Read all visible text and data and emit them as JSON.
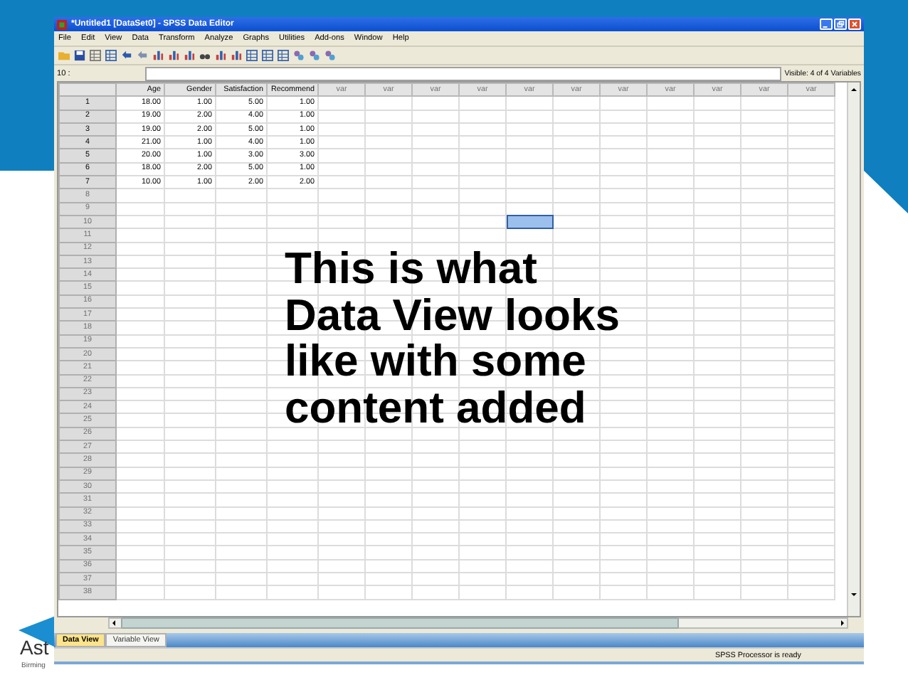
{
  "slide": {
    "caption": "This is what\nData View looks\nlike with some\ncontent added",
    "logo": {
      "name": "Ast",
      "subtitle": "Birming"
    }
  },
  "window": {
    "title": "*Untitled1 [DataSet0] - SPSS Data Editor"
  },
  "menu": [
    "File",
    "Edit",
    "View",
    "Data",
    "Transform",
    "Analyze",
    "Graphs",
    "Utilities",
    "Add-ons",
    "Window",
    "Help"
  ],
  "cell_editor": {
    "cell_ref": "10 :",
    "visible": "Visible: 4 of 4 Variables"
  },
  "table": {
    "columns": [
      {
        "label": "Age",
        "kind": "variable",
        "selected": false
      },
      {
        "label": "Gender",
        "kind": "variable",
        "selected": false
      },
      {
        "label": "Satisfaction",
        "kind": "variable",
        "selected": false
      },
      {
        "label": "Recommend",
        "kind": "variable",
        "selected": false
      },
      {
        "label": "var",
        "kind": "empty",
        "selected": false
      },
      {
        "label": "var",
        "kind": "empty",
        "selected": false
      },
      {
        "label": "var",
        "kind": "empty",
        "selected": false
      },
      {
        "label": "var",
        "kind": "empty",
        "selected": false
      },
      {
        "label": "var",
        "kind": "empty",
        "selected": true
      },
      {
        "label": "var",
        "kind": "empty",
        "selected": false
      },
      {
        "label": "var",
        "kind": "empty",
        "selected": false
      },
      {
        "label": "var",
        "kind": "empty",
        "selected": false
      },
      {
        "label": "var",
        "kind": "empty",
        "selected": false
      },
      {
        "label": "var",
        "kind": "empty",
        "selected": false
      },
      {
        "label": "var",
        "kind": "empty",
        "selected": false
      }
    ],
    "rows": [
      {
        "number": "1",
        "kind": "data",
        "selected": false,
        "cells": [
          "18.00",
          "1.00",
          "5.00",
          "1.00"
        ]
      },
      {
        "number": "2",
        "kind": "data",
        "selected": false,
        "cells": [
          "19.00",
          "2.00",
          "4.00",
          "1.00"
        ]
      },
      {
        "number": "3",
        "kind": "data",
        "selected": false,
        "cells": [
          "19.00",
          "2.00",
          "5.00",
          "1.00"
        ]
      },
      {
        "number": "4",
        "kind": "data",
        "selected": false,
        "cells": [
          "21.00",
          "1.00",
          "4.00",
          "1.00"
        ]
      },
      {
        "number": "5",
        "kind": "data",
        "selected": false,
        "cells": [
          "20.00",
          "1.00",
          "3.00",
          "3.00"
        ]
      },
      {
        "number": "6",
        "kind": "data",
        "selected": false,
        "cells": [
          "18.00",
          "2.00",
          "5.00",
          "1.00"
        ]
      },
      {
        "number": "7",
        "kind": "data",
        "selected": false,
        "cells": [
          "10.00",
          "1.00",
          "2.00",
          "2.00"
        ]
      },
      {
        "number": "8",
        "kind": "empty",
        "selected": false
      },
      {
        "number": "9",
        "kind": "empty",
        "selected": false
      },
      {
        "number": "10",
        "kind": "empty",
        "selected": true
      },
      {
        "number": "11",
        "kind": "empty",
        "selected": false
      },
      {
        "number": "12",
        "kind": "empty",
        "selected": false
      },
      {
        "number": "13",
        "kind": "empty",
        "selected": false
      },
      {
        "number": "14",
        "kind": "empty",
        "selected": false
      },
      {
        "number": "15",
        "kind": "empty",
        "selected": false
      },
      {
        "number": "16",
        "kind": "empty",
        "selected": false
      },
      {
        "number": "17",
        "kind": "empty",
        "selected": false
      },
      {
        "number": "18",
        "kind": "empty",
        "selected": false
      },
      {
        "number": "19",
        "kind": "empty",
        "selected": false
      },
      {
        "number": "20",
        "kind": "empty",
        "selected": false
      },
      {
        "number": "21",
        "kind": "empty",
        "selected": false
      },
      {
        "number": "22",
        "kind": "empty",
        "selected": false
      },
      {
        "number": "23",
        "kind": "empty",
        "selected": false
      },
      {
        "number": "24",
        "kind": "empty",
        "selected": false
      },
      {
        "number": "25",
        "kind": "empty",
        "selected": false
      },
      {
        "number": "26",
        "kind": "empty",
        "selected": false
      },
      {
        "number": "27",
        "kind": "empty",
        "selected": false
      },
      {
        "number": "28",
        "kind": "empty",
        "selected": false
      },
      {
        "number": "29",
        "kind": "empty",
        "selected": false
      },
      {
        "number": "30",
        "kind": "empty",
        "selected": false
      },
      {
        "number": "31",
        "kind": "empty",
        "selected": false
      },
      {
        "number": "32",
        "kind": "empty",
        "selected": false
      },
      {
        "number": "33",
        "kind": "empty",
        "selected": false
      },
      {
        "number": "34",
        "kind": "empty",
        "selected": false
      },
      {
        "number": "35",
        "kind": "empty",
        "selected": false
      },
      {
        "number": "36",
        "kind": "empty",
        "selected": false
      },
      {
        "number": "37",
        "kind": "empty",
        "selected": false
      },
      {
        "number": "38",
        "kind": "empty",
        "selected": false
      }
    ]
  },
  "tabs": [
    {
      "label": "Data View",
      "selected": true
    },
    {
      "label": "Variable View",
      "selected": false
    }
  ],
  "status_bar": {
    "text": "SPSS Processor is ready"
  }
}
